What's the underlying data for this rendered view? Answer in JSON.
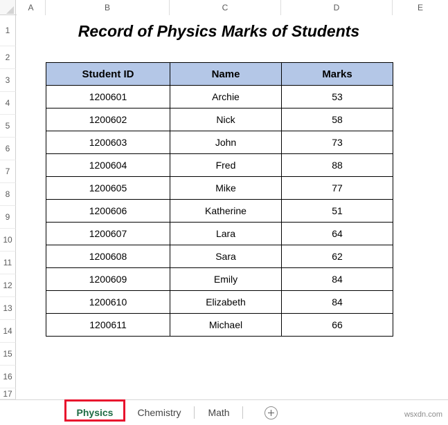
{
  "app": {
    "kind": "spreadsheet",
    "watermark": "wsxdn.com"
  },
  "grid": {
    "column_headers": [
      "A",
      "B",
      "C",
      "D",
      "E"
    ],
    "row_headers": [
      "1",
      "2",
      "3",
      "4",
      "5",
      "6",
      "7",
      "8",
      "9",
      "10",
      "11",
      "12",
      "13",
      "14",
      "15",
      "16",
      "17"
    ]
  },
  "title": {
    "text": "Record of Physics Marks of Students"
  },
  "table": {
    "headers": [
      "Student ID",
      "Name",
      "Marks"
    ],
    "header_fill": "#B4C7E7",
    "rows": [
      {
        "id": "1200601",
        "name": "Archie",
        "marks": "53"
      },
      {
        "id": "1200602",
        "name": "Nick",
        "marks": "58"
      },
      {
        "id": "1200603",
        "name": "John",
        "marks": "73"
      },
      {
        "id": "1200604",
        "name": "Fred",
        "marks": "88"
      },
      {
        "id": "1200605",
        "name": "Mike",
        "marks": "77"
      },
      {
        "id": "1200606",
        "name": "Katherine",
        "marks": "51"
      },
      {
        "id": "1200607",
        "name": "Lara",
        "marks": "64"
      },
      {
        "id": "1200608",
        "name": "Sara",
        "marks": "62"
      },
      {
        "id": "1200609",
        "name": "Emily",
        "marks": "84"
      },
      {
        "id": "1200610",
        "name": "Elizabeth",
        "marks": "84"
      },
      {
        "id": "1200611",
        "name": "Michael",
        "marks": "66"
      }
    ]
  },
  "tabs": {
    "items": [
      {
        "label": "Physics",
        "active": true
      },
      {
        "label": "Chemistry",
        "active": false
      },
      {
        "label": "Math",
        "active": false
      }
    ],
    "active_color": "#1D6B43",
    "add_sheet_icon": "plus-circle-icon",
    "highlight_color": "#E8112D"
  }
}
